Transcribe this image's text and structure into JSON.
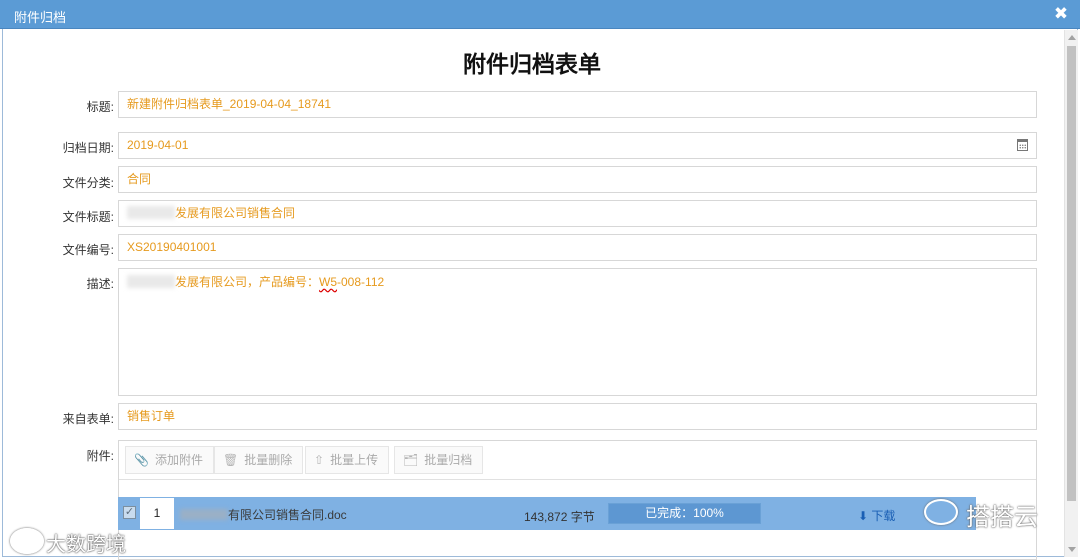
{
  "window": {
    "title": "附件归档",
    "close_glyph": "✖"
  },
  "form": {
    "title": "附件归档表单",
    "fields": {
      "title": {
        "label": "标题:",
        "value": "新建附件归档表单_2019-04-04_18741"
      },
      "archive_date": {
        "label": "归档日期:",
        "value": "2019-04-01"
      },
      "category": {
        "label": "文件分类:",
        "value": "合同"
      },
      "doc_title": {
        "label": "文件标题:",
        "value": "发展有限公司销售合同"
      },
      "doc_number": {
        "label": "文件编号:",
        "value": "XS20190401001"
      },
      "description": {
        "label": "描述:",
        "value_prefix": "发展有限公司，产品编号：",
        "value_mark": "W5",
        "value_suffix": "-008-112"
      },
      "source_form": {
        "label": "来自表单:",
        "value": "销售订单"
      },
      "attachments": {
        "label": "附件:"
      }
    }
  },
  "toolbar": {
    "add": "添加附件",
    "batch_delete": "批量删除",
    "batch_upload": "批量上传",
    "batch_archive": "批量归档"
  },
  "attachment_rows": [
    {
      "index": "1",
      "filename": "有限公司销售合同.doc",
      "size": "143,872 字节",
      "status": "已完成：100%",
      "progress": 1.0,
      "download": "下载"
    }
  ],
  "watermarks": {
    "right": "搭搭云",
    "left": "大数跨境"
  },
  "colors": {
    "titlebar": "#5b9bd5",
    "value_text": "#e69a1e",
    "row_selected": "#7fb1e3",
    "link": "#1a5fb4"
  }
}
